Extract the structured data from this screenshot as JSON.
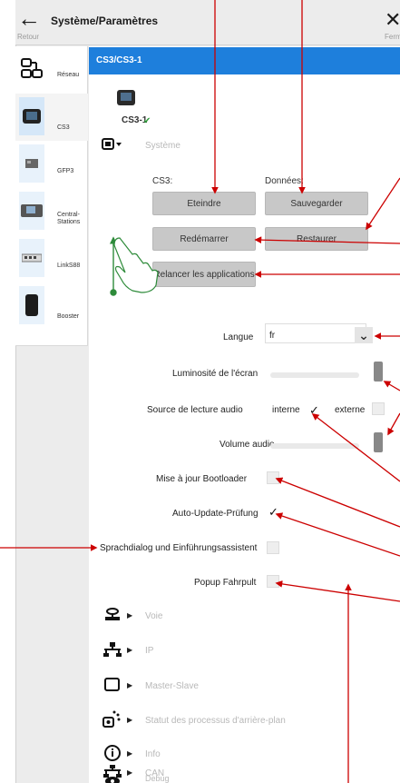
{
  "titlebar": {
    "back_label": "Retour",
    "title": "Système/Paramètres",
    "close_label": "Fermer"
  },
  "sidebar": {
    "items": [
      {
        "label": "Réseau",
        "icon": "network-icon"
      },
      {
        "label": "CS3",
        "icon": "cs3-device-icon"
      },
      {
        "label": "GFP3",
        "icon": "gfp3-icon"
      },
      {
        "label": "Central-\nStations",
        "icon": "central-stations-icon"
      },
      {
        "label": "LinkS88",
        "icon": "links88-icon"
      },
      {
        "label": "Booster",
        "icon": "booster-icon"
      }
    ]
  },
  "device": {
    "header": "CS3/CS3-1",
    "name": "CS3-1"
  },
  "system_section": {
    "label": "Système",
    "col_cs3": "CS3:",
    "col_data": "Données:",
    "btn_shutdown": "Eteindre",
    "btn_save": "Sauvegarder",
    "btn_restart": "Redémarrer",
    "btn_restore": "Restaurer",
    "btn_relaunch": "Relancer les applications"
  },
  "settings": {
    "language_label": "Langue",
    "language_value": "fr",
    "brightness_label": "Luminosité de l'écran",
    "brightness_level": 0.97,
    "audio_source_label": "Source de lecture audio",
    "audio_internal": "interne",
    "audio_external": "externe",
    "audio_volume_label": "Volume audio",
    "audio_volume_level": 0.97,
    "bootloader_label": "Mise à jour Bootloader",
    "autoupdate_label": "Auto-Update-Prüfung",
    "speechdialog_label": "Sprachdialog und Einführungsassistent",
    "popup_label": "Popup Fahrpult"
  },
  "sections": [
    {
      "label": "Voie",
      "icon": "track-icon"
    },
    {
      "label": "IP",
      "icon": "ip-network-icon"
    },
    {
      "label": "Master-Slave",
      "icon": "master-slave-icon"
    },
    {
      "label": "Statut des processus d'arrière-plan",
      "icon": "background-process-icon"
    },
    {
      "label": "Info",
      "icon": "info-icon"
    },
    {
      "label": "CAN",
      "icon": "can-bus-icon"
    },
    {
      "label": "Debug",
      "icon": "debug-eye-icon"
    }
  ],
  "colors": {
    "accent": "#1e7fdc",
    "annotation": "#cc0000",
    "annotation_green": "#2e8b3a",
    "check_green": "#2e9c3a"
  }
}
